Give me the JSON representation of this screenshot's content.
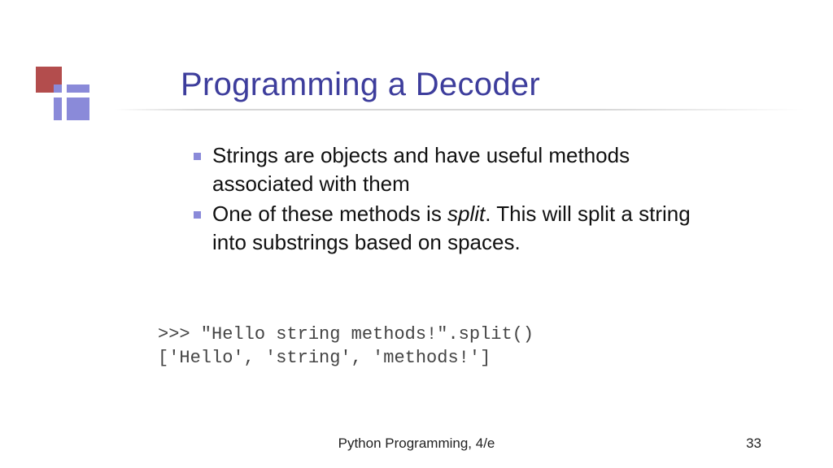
{
  "title": "Programming a Decoder",
  "bullets": {
    "b1": "Strings are objects and have useful methods associated with them",
    "b2a": "One of these methods is ",
    "b2em": "split",
    "b2b": ". This will split a string into substrings based on spaces."
  },
  "code": {
    "line1": ">>> \"Hello string methods!\".split()",
    "line2": "['Hello', 'string', 'methods!']"
  },
  "footer": "Python Programming, 4/e",
  "page": "33"
}
